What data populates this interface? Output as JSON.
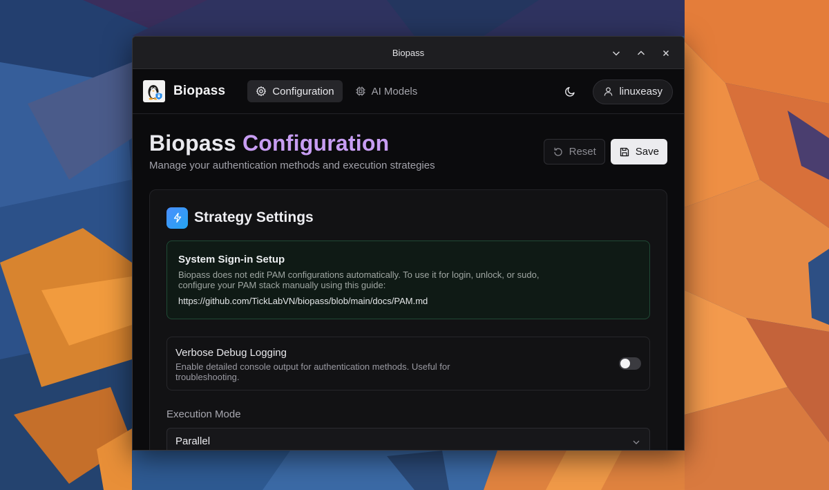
{
  "window": {
    "title": "Biopass"
  },
  "app": {
    "brand": "Biopass",
    "nav": [
      {
        "label": "Configuration",
        "icon": "gear-icon",
        "active": true
      },
      {
        "label": "AI Models",
        "icon": "cpu-icon",
        "active": false
      }
    ],
    "user": "linuxeasy"
  },
  "page": {
    "title_part1": "Biopass",
    "title_part2": "Configuration",
    "subtitle": "Manage your authentication methods and execution strategies",
    "reset_label": "Reset",
    "save_label": "Save"
  },
  "strategy": {
    "title": "Strategy Settings",
    "setup": {
      "title": "System Sign-in Setup",
      "text": "Biopass does not edit PAM configurations automatically. To use it for login, unlock, or sudo, configure your PAM stack manually using this guide:",
      "link": "https://github.com/TickLabVN/biopass/blob/main/docs/PAM.md"
    },
    "verbose": {
      "title": "Verbose Debug Logging",
      "description": "Enable detailed console output for authentication methods. Useful for troubleshooting.",
      "enabled": false
    },
    "execution_mode": {
      "label": "Execution Mode",
      "value": "Parallel"
    }
  },
  "colors": {
    "accent": "#c79df2",
    "bolt_gradient_start": "#4a8fff",
    "bolt_gradient_end": "#24a4f0",
    "info_border": "#1f4a35"
  }
}
